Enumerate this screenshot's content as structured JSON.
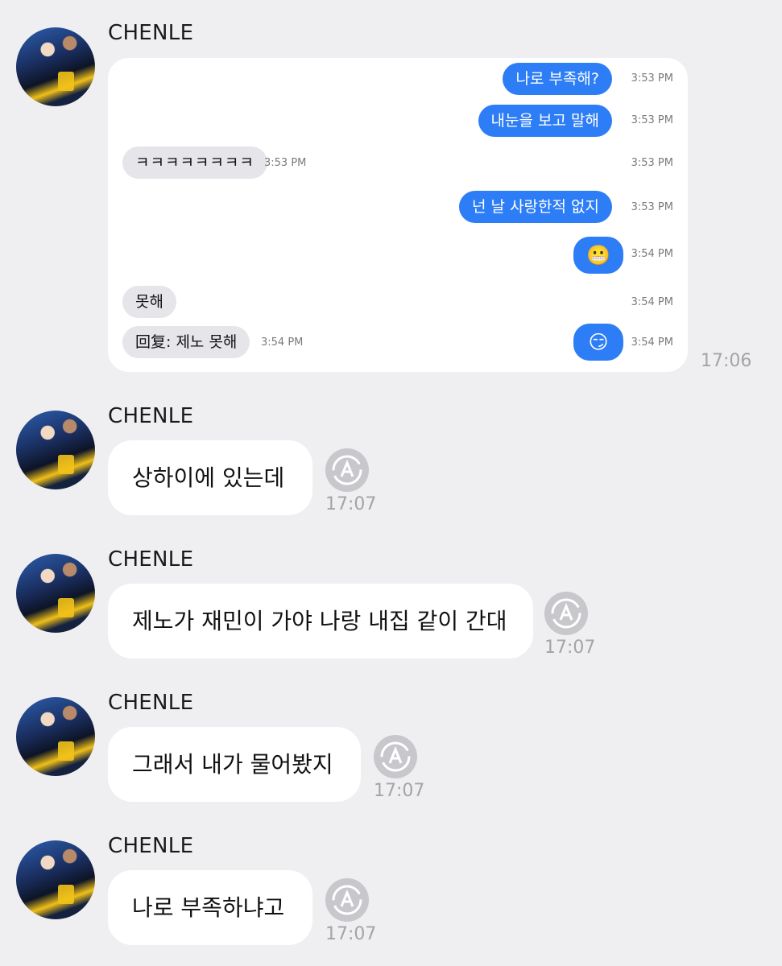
{
  "messages": [
    {
      "sender": "CHENLE",
      "type": "image",
      "time": "17:06"
    },
    {
      "sender": "CHENLE",
      "type": "text",
      "text": "상하이에 있는데",
      "time": "17:07"
    },
    {
      "sender": "CHENLE",
      "type": "text",
      "text": "제노가 재민이 가야 나랑 내집 같이 간대",
      "time": "17:07"
    },
    {
      "sender": "CHENLE",
      "type": "text",
      "text": "그래서 내가 물어봤지",
      "time": "17:07"
    },
    {
      "sender": "CHENLE",
      "type": "text",
      "text": "나로 부족하냐고",
      "time": "17:07"
    }
  ],
  "screenshot": {
    "rows": [
      {
        "side": "out",
        "text": "나로 부족해?",
        "time": "3:53 PM"
      },
      {
        "side": "out",
        "text": "내눈을 보고 말해",
        "time": "3:53 PM"
      },
      {
        "side": "in",
        "text": "ㅋㅋㅋㅋㅋㅋㅋㅋ",
        "time": "3:53 PM",
        "right_time": "3:53 PM"
      },
      {
        "side": "out",
        "text": "넌 날 사랑한적 없지",
        "time": "3:53 PM"
      },
      {
        "side": "out",
        "text": "😬",
        "time": "3:54 PM"
      },
      {
        "side": "in",
        "text": "못해",
        "right_time": "3:54 PM"
      },
      {
        "side": "in",
        "text": "回复: 제노 못해",
        "time": "3:54 PM"
      },
      {
        "side": "out",
        "text": "😏",
        "time": "3:54 PM"
      }
    ]
  },
  "colors": {
    "background": "#efeff1",
    "out_bubble": "#2d7df6",
    "in_bubble": "#e5e5ea",
    "sync_icon": "#c8c8cc"
  },
  "icons": {
    "status": "translate-sync-icon"
  }
}
